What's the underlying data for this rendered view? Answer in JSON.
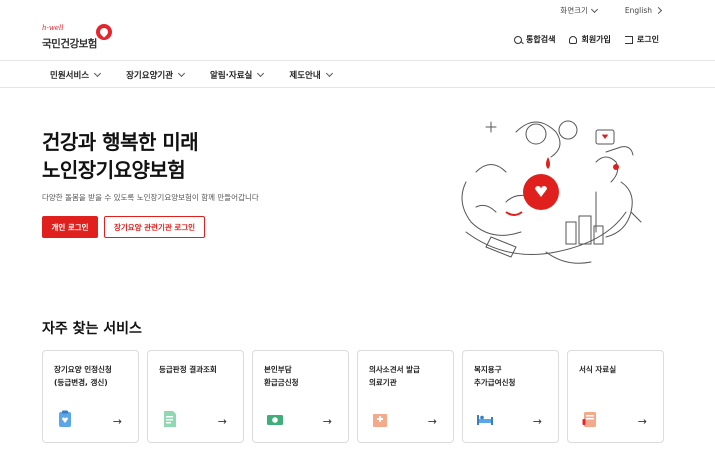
{
  "util": {
    "font_size_label": "화면크기",
    "language": "English"
  },
  "logo": {
    "en": "h-well",
    "ko": "국민건강보험"
  },
  "header_actions": [
    {
      "label": "통합검색",
      "icon": "search-icon"
    },
    {
      "label": "회원가입",
      "icon": "user-icon"
    },
    {
      "label": "로그인",
      "icon": "login-icon"
    }
  ],
  "nav": {
    "items": [
      {
        "label": "민원서비스"
      },
      {
        "label": "장기요양기관"
      },
      {
        "label": "알림·자료실"
      },
      {
        "label": "제도안내"
      }
    ]
  },
  "hero": {
    "title_line1": "건강과 행복한 미래",
    "title_line2": "노인장기요양보험",
    "description": "다양한 돌봄을 받을 수 있도록 노인장기요양보험이 함께 만들어갑니다",
    "primary_button": "개인 로그인",
    "secondary_button": "장기요양 관련기관 로그인"
  },
  "services": {
    "title": "자주 찾는 서비스",
    "cards": [
      {
        "label": "장기요양 인정신청\n(등급변경, 갱신)",
        "icon": "application-icon"
      },
      {
        "label": "등급판정 결과조회",
        "icon": "document-icon"
      },
      {
        "label": "본인부담\n환급금신청",
        "icon": "money-icon"
      },
      {
        "label": "의사소견서 발급\n의료기관",
        "icon": "hospital-icon"
      },
      {
        "label": "복지용구\n추가급여신청",
        "icon": "bed-icon"
      },
      {
        "label": "서식 자료실",
        "icon": "folder-icon"
      }
    ]
  },
  "colors": {
    "brand_red": "#e0201c",
    "text": "#222222",
    "border": "#dcdcdc"
  }
}
